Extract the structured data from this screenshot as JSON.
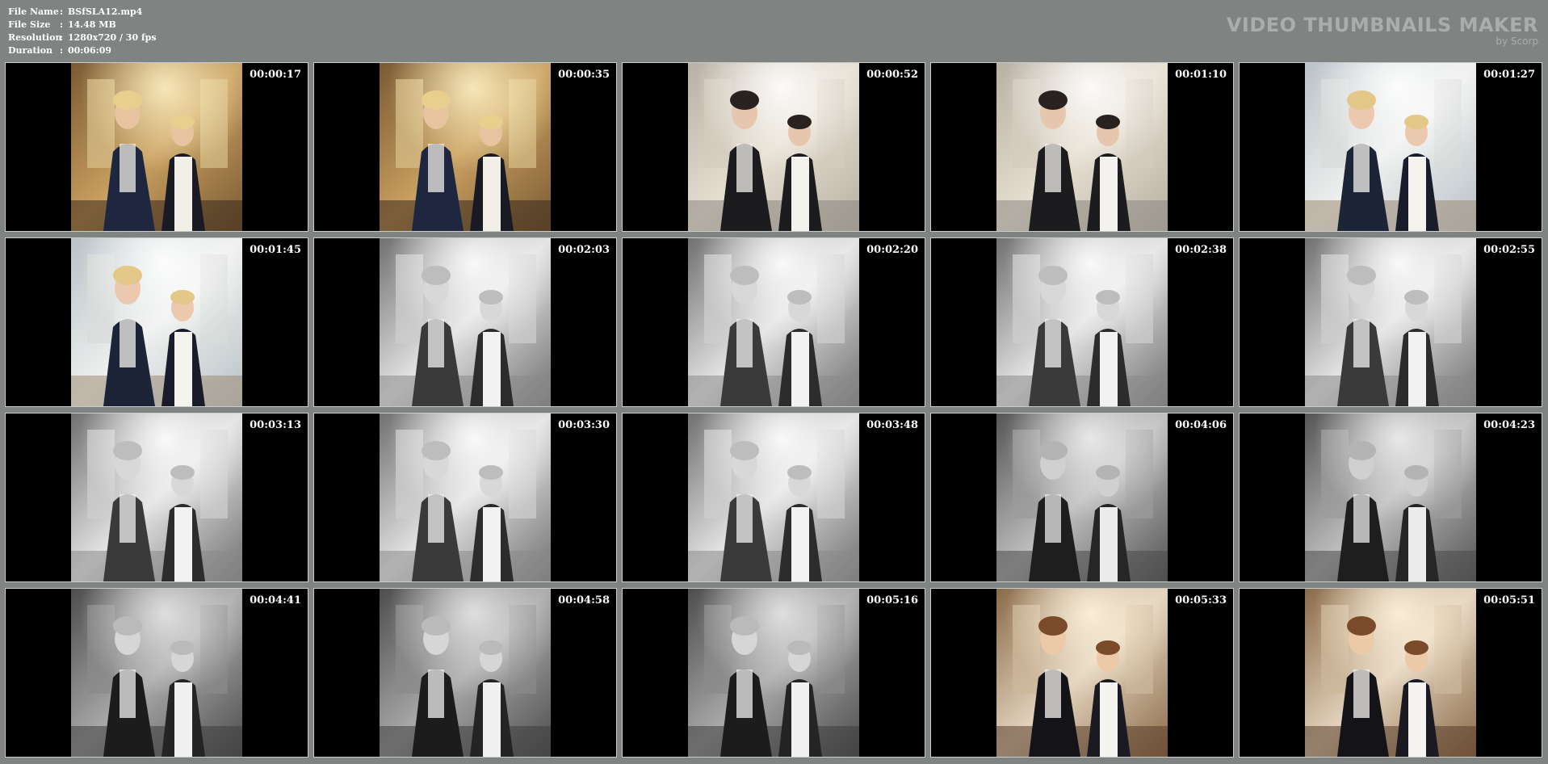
{
  "info": {
    "file_name_label": "File Name",
    "file_name": "BSfSLA12.mp4",
    "file_size_label": "File Size",
    "file_size": "14.48 MB",
    "resolution_label": "Resolution",
    "resolution": "1280x720 / 30 fps",
    "duration_label": "Duration",
    "duration": "00:06:09",
    "separator": ":"
  },
  "brand": {
    "title": "VIDEO THUMBNAILS MAKER",
    "subtitle": "by Scorp"
  },
  "thumbnails": [
    {
      "time": "00:00:17",
      "scene": "color-warm-a"
    },
    {
      "time": "00:00:35",
      "scene": "color-warm-a"
    },
    {
      "time": "00:00:52",
      "scene": "color-pale-b"
    },
    {
      "time": "00:01:10",
      "scene": "color-pale-b"
    },
    {
      "time": "00:01:27",
      "scene": "color-blue-c"
    },
    {
      "time": "00:01:45",
      "scene": "color-blue-c"
    },
    {
      "time": "00:02:03",
      "scene": "mono-d"
    },
    {
      "time": "00:02:20",
      "scene": "mono-d"
    },
    {
      "time": "00:02:38",
      "scene": "mono-d"
    },
    {
      "time": "00:02:55",
      "scene": "mono-d"
    },
    {
      "time": "00:03:13",
      "scene": "mono-d"
    },
    {
      "time": "00:03:30",
      "scene": "mono-d"
    },
    {
      "time": "00:03:48",
      "scene": "mono-d"
    },
    {
      "time": "00:04:06",
      "scene": "mono-e"
    },
    {
      "time": "00:04:23",
      "scene": "mono-e"
    },
    {
      "time": "00:04:41",
      "scene": "mono-f"
    },
    {
      "time": "00:04:58",
      "scene": "mono-f"
    },
    {
      "time": "00:05:16",
      "scene": "mono-f"
    },
    {
      "time": "00:05:33",
      "scene": "color-warm-g"
    },
    {
      "time": "00:05:51",
      "scene": "color-warm-g"
    }
  ],
  "colors": {
    "background": "#7f8382",
    "tile_border": "#c9cccb",
    "text": "#ffffff",
    "brand": "#a9adac"
  }
}
